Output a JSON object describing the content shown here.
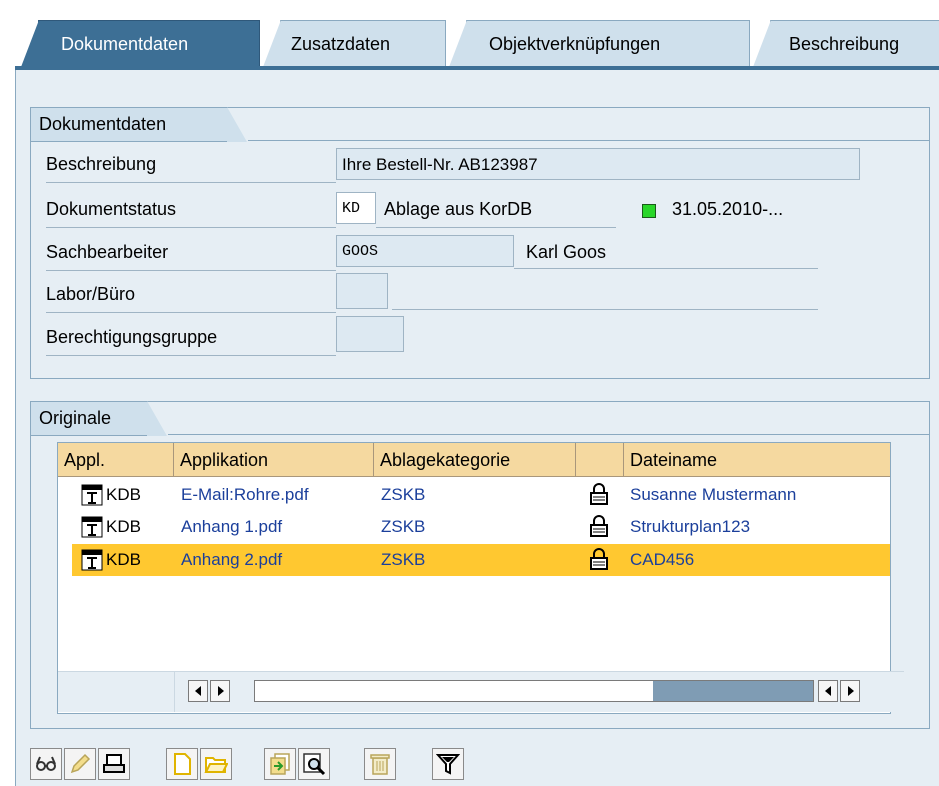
{
  "tabs": [
    {
      "label": "Dokumentdaten",
      "active": true
    },
    {
      "label": "Zusatzdaten",
      "active": false
    },
    {
      "label": "Objektverknüpfungen",
      "active": false
    },
    {
      "label": "Beschreibung",
      "active": false
    }
  ],
  "doc_group": {
    "title": "Dokumentdaten",
    "rows": {
      "beschreibung": {
        "label": "Beschreibung",
        "value": "Ihre Bestell-Nr. AB123987"
      },
      "dokumentstatus": {
        "label": "Dokumentstatus",
        "code": "KD",
        "text": "Ablage aus KorDB",
        "status_color": "#29d629",
        "date": "31.05.2010-..."
      },
      "sachbearbeiter": {
        "label": "Sachbearbeiter",
        "code": "GOOS",
        "name": "Karl Goos"
      },
      "labor": {
        "label": "Labor/Büro",
        "value": ""
      },
      "berechtigung": {
        "label": "Berechtigungsgruppe",
        "value": ""
      }
    }
  },
  "originale": {
    "title": "Originale",
    "columns": [
      "Appl.",
      "Applikation",
      "Ablagekategorie",
      "",
      "Dateiname"
    ],
    "rows": [
      {
        "appl": "KDB",
        "applikation": "E-Mail:Rohre.pdf",
        "kategorie": "ZSKB",
        "dateiname": "Susanne Mustermann",
        "selected": false
      },
      {
        "appl": "KDB",
        "applikation": "Anhang 1.pdf",
        "kategorie": "ZSKB",
        "dateiname": "Strukturplan123",
        "selected": false
      },
      {
        "appl": "KDB",
        "applikation": "Anhang 2.pdf",
        "kategorie": "ZSKB",
        "dateiname": "CAD456",
        "selected": true
      }
    ]
  },
  "toolbar": [
    "display-icon",
    "change-icon",
    "print-icon",
    "create-icon",
    "open-icon",
    "copy-icon",
    "search-icon",
    "delete-icon",
    "filter-icon"
  ],
  "colors": {
    "selected_row": "#ffc830",
    "active_tab": "#3d6f95",
    "header": "#f5d9a0"
  }
}
